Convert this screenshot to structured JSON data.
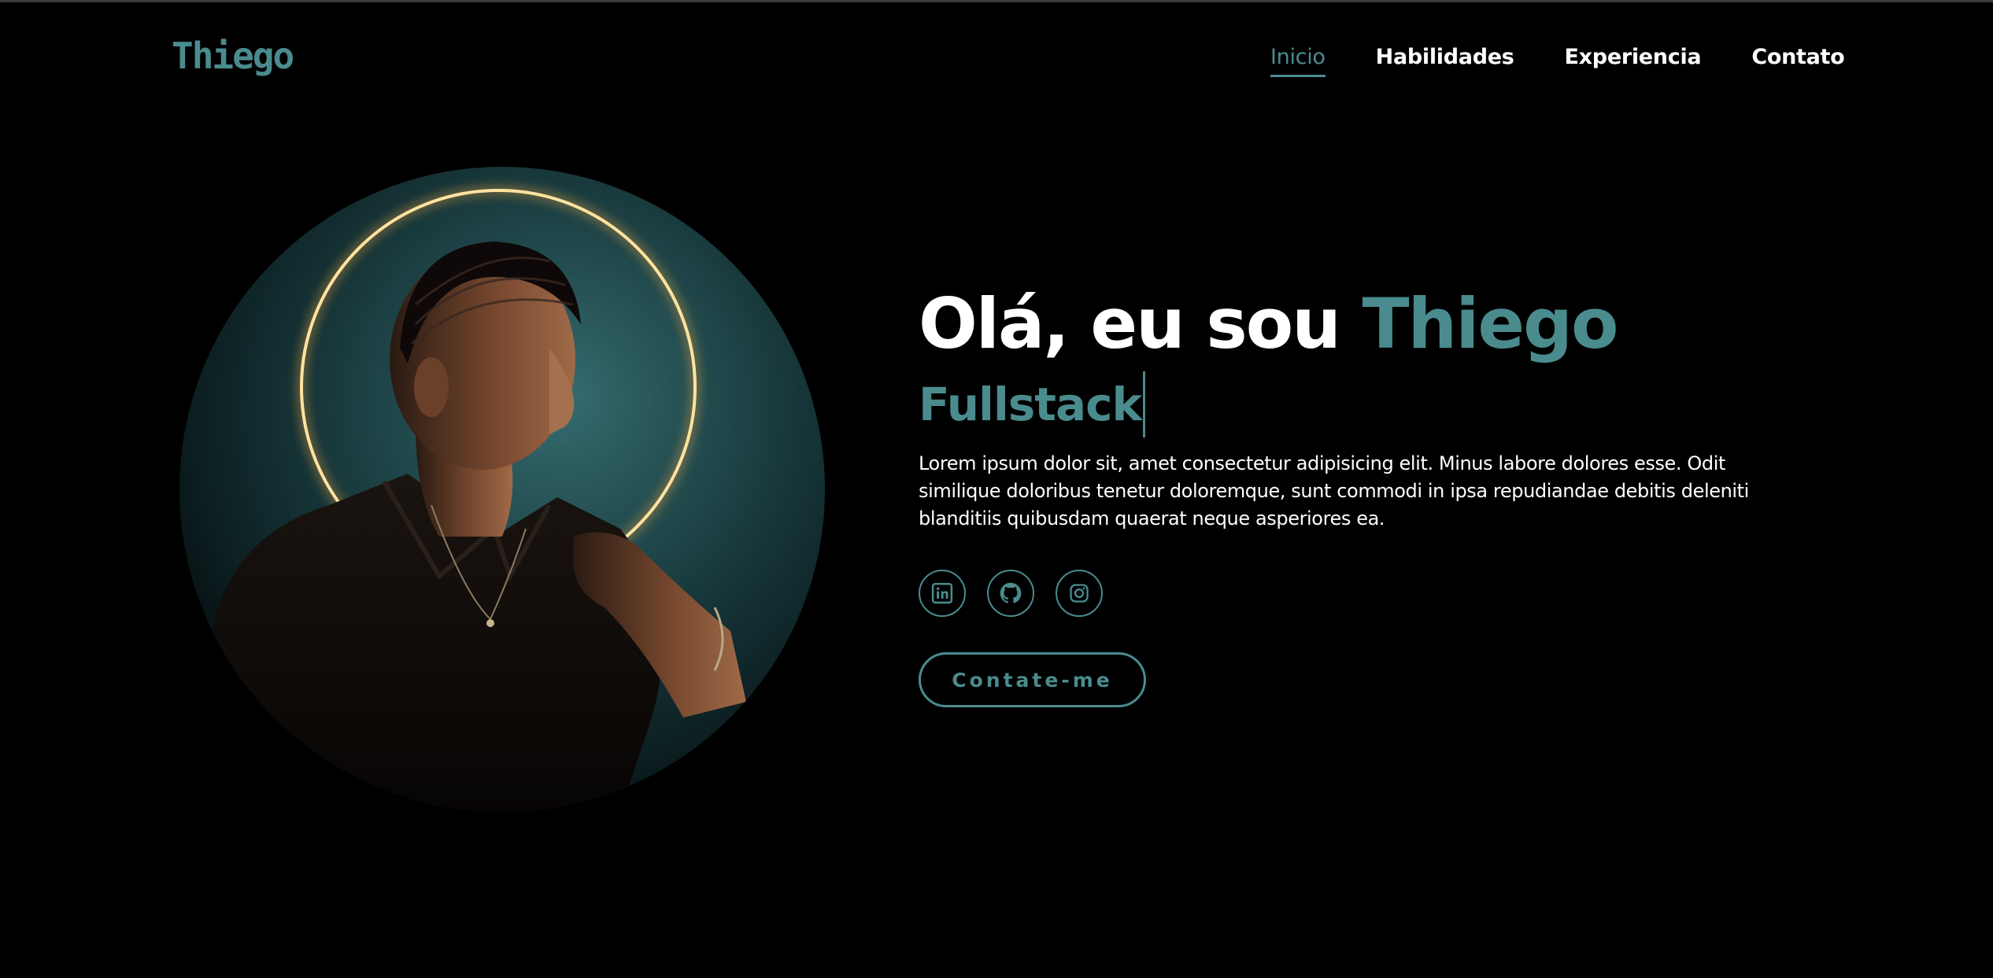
{
  "header": {
    "logo": "Thiego",
    "nav": [
      {
        "label": "Inicio",
        "active": true
      },
      {
        "label": "Habilidades",
        "active": false
      },
      {
        "label": "Experiencia",
        "active": false
      },
      {
        "label": "Contato",
        "active": false
      }
    ]
  },
  "hero": {
    "greeting": "Olá, eu sou ",
    "name": "Thiego",
    "role": "Fullstack",
    "description": "Lorem ipsum dolor sit, amet consectetur adipisicing elit. Minus labore dolores esse. Odit similique doloribus tenetur doloremque, sunt commodi in ipsa repudiandae debitis deleniti blanditiis quibusdam quaerat neque asperiores ea.",
    "socials": [
      {
        "icon": "linkedin-icon"
      },
      {
        "icon": "github-icon"
      },
      {
        "icon": "instagram-icon"
      }
    ],
    "cta_label": "Contate-me",
    "photo_icon": "portrait-photo"
  },
  "colors": {
    "background": "#000000",
    "accent": "#4a8b8e",
    "text": "#ffffff",
    "halo": "#f5c36a"
  }
}
